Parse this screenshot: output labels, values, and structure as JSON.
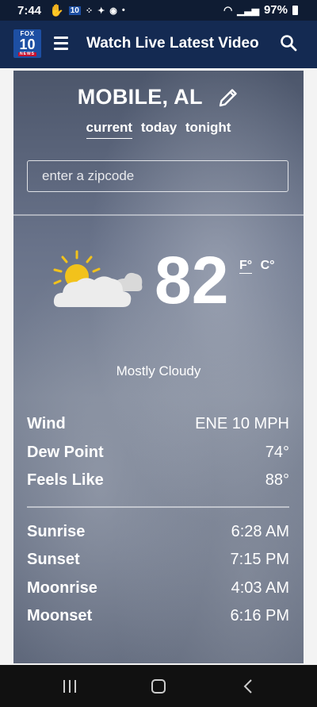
{
  "status_bar": {
    "time": "7:44",
    "battery": "97%"
  },
  "nav": {
    "logo_top": "FOX",
    "logo_number": "10",
    "logo_bottom": "NEWS",
    "watch_live": "Watch Live",
    "latest_video": "Latest Video"
  },
  "weather": {
    "location": "MOBILE, AL",
    "tabs": [
      {
        "label": "current",
        "active": true
      },
      {
        "label": "today",
        "active": false
      },
      {
        "label": "tonight",
        "active": false
      }
    ],
    "zip_placeholder": "enter a zipcode",
    "temperature": "82",
    "unit_f": "F°",
    "unit_c": "C°",
    "condition": "Mostly Cloudy",
    "icon": "partly-cloudy-icon",
    "details": [
      {
        "label": "Wind",
        "value": "ENE 10 MPH"
      },
      {
        "label": "Dew Point",
        "value": "74°"
      },
      {
        "label": "Feels Like",
        "value": "88°"
      }
    ],
    "astronomy": [
      {
        "label": "Sunrise",
        "value": "6:28 AM"
      },
      {
        "label": "Sunset",
        "value": "7:15 PM"
      },
      {
        "label": "Moonrise",
        "value": "4:03 AM"
      },
      {
        "label": "Moonset",
        "value": "6:16 PM"
      }
    ]
  },
  "colors": {
    "nav_bg": "#142a52",
    "status_bg": "#0f1c33",
    "sun": "#f2c21b"
  }
}
